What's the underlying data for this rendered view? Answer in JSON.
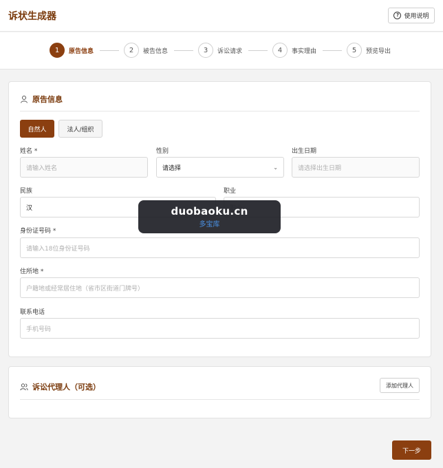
{
  "header": {
    "title": "诉状生成器",
    "help_label": "使用说明"
  },
  "steps": [
    {
      "num": "1",
      "label": "原告信息",
      "active": true
    },
    {
      "num": "2",
      "label": "被告信息",
      "active": false
    },
    {
      "num": "3",
      "label": "诉讼请求",
      "active": false
    },
    {
      "num": "4",
      "label": "事实理由",
      "active": false
    },
    {
      "num": "5",
      "label": "预览导出",
      "active": false
    }
  ],
  "plaintiff": {
    "section_title": "原告信息",
    "type_tabs": {
      "natural": "自然人",
      "legal": "法人/组织"
    },
    "name": {
      "label": "姓名 *",
      "placeholder": "请输入姓名"
    },
    "gender": {
      "label": "性别",
      "value": "请选择"
    },
    "birth": {
      "label": "出生日期",
      "placeholder": "请选择出生日期"
    },
    "ethnicity": {
      "label": "民族",
      "value": "汉"
    },
    "occupation": {
      "label": "职业",
      "placeholder": "职业"
    },
    "id_number": {
      "label": "身份证号码 *",
      "placeholder": "请输入18位身份证号码"
    },
    "address": {
      "label": "住所地 *",
      "placeholder": "户籍地或经常居住地（省市区街道门牌号）"
    },
    "phone": {
      "label": "联系电话",
      "placeholder": "手机号码"
    }
  },
  "agent": {
    "section_title": "诉讼代理人（可选）",
    "add_label": "添加代理人"
  },
  "footer": {
    "next_label": "下一步"
  },
  "watermark": {
    "main": "duobaoku.cn",
    "sub": "多宝库"
  },
  "colors": {
    "accent": "#8b3f10",
    "title": "#7a3a0c"
  }
}
